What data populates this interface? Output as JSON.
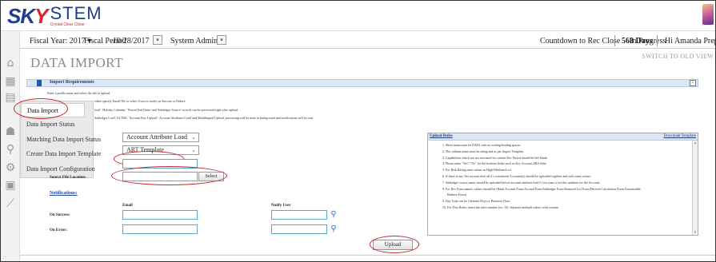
{
  "brand": {
    "logo_sky": "SK",
    "logo_y": "Y",
    "logo_stem": "STEM",
    "logo_tagline": "Crystal Clear Close"
  },
  "header": {
    "fiscal_year": "Fiscal Year: 2017 ▾",
    "fiscal_period_label": "Fiscal Period",
    "fiscal_period_value": "10/28/2017",
    "role": "System Admin",
    "countdown_label": "Countdown to Rec Close",
    "countdown_value": "568 Days",
    "status": "In Progress",
    "greeting": "Hi Amanda Prep ▾"
  },
  "page": {
    "title": "DATA IMPORT",
    "switch_link": "SWITCH TO OLD VIEW"
  },
  "requirements": {
    "title": "Import Requirements",
    "lines": [
      "Enter a profile name and select the file to upload.",
      "either specify Email IDs or select Users to notify on Success or Failure.",
      "load', 'Holiday Calendar', 'Period End Dates' and 'Subledger Source' records can be previewed right after upload.",
      "Subledger Load','GLTBS', 'Account Key Upload', 'Account Attributes Load' and Multilingual Upload, processing will be done in background and notifications will be sent."
    ]
  },
  "menu": {
    "items": [
      "Data Import",
      "Data Import Status",
      "Matching Data Import Status",
      "Create Data Import Template",
      "Data Import Configuration"
    ]
  },
  "form": {
    "import_type": "Account Attribute Load",
    "template": "ART Template",
    "source_file_label": "Source File Location:",
    "select_button": "Select",
    "notifications_label": "Notifications:",
    "email_header": "Email",
    "notify_user_header": "Notify User",
    "on_success_label": "On Success:",
    "on_error_label": "On Error:",
    "upload_button": "Upload"
  },
  "upload_rules": {
    "title": "Upload Rules",
    "download_link": "Download Template",
    "items": [
      "1. Sheet name must be DATA with no trailing/leading spaces.",
      "2. The column name must be string and as per Import Template.",
      "3. Capabilities which are not activated for current Rec Period should be left blank.",
      "4. Please enter \"Yes\"/\"No\" for the boolean fields such as Key Account,ZBA field.",
      "5. For Risk Rating enter values as High/Medium/Low.",
      "6. If there is any Net account then all it's constituent Accounts(s) should be uploaded together and with same values.",
      "7. Subledger source name should be uploaded before account attribute load if you want to set this attribute for the Account.",
      "8. For Rec Form names, values should be (Bank Account Form/Accrual Form/Subledger Form/Itemized List Form/Derived Calculation Form/Amortizable",
      "Balance Form)",
      "9. Day Type can be Calendar Days or Business Days.",
      "10. For Flux Rules, insert the rules number (ex: 10). Separate multiple values with comma."
    ]
  }
}
